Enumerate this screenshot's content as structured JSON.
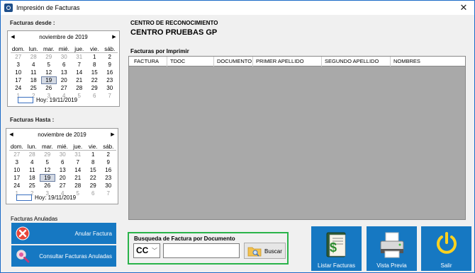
{
  "window": {
    "title": "Impresión de Facturas",
    "close_glyph": "✕"
  },
  "calendar_from": {
    "label": "Facturas desde :",
    "month": "noviembre de 2019",
    "days_of_week": [
      "dom.",
      "lun.",
      "mar.",
      "mié.",
      "jue.",
      "vie.",
      "sáb."
    ],
    "weeks": [
      [
        [
          "27",
          "o"
        ],
        [
          "28",
          "o"
        ],
        [
          "29",
          "o"
        ],
        [
          "30",
          "o"
        ],
        [
          "31",
          "o"
        ],
        [
          "1",
          ""
        ],
        [
          "2",
          ""
        ]
      ],
      [
        [
          "3",
          ""
        ],
        [
          "4",
          ""
        ],
        [
          "5",
          ""
        ],
        [
          "6",
          ""
        ],
        [
          "7",
          ""
        ],
        [
          "8",
          ""
        ],
        [
          "9",
          ""
        ]
      ],
      [
        [
          "10",
          ""
        ],
        [
          "11",
          ""
        ],
        [
          "12",
          ""
        ],
        [
          "13",
          ""
        ],
        [
          "14",
          ""
        ],
        [
          "15",
          ""
        ],
        [
          "16",
          ""
        ]
      ],
      [
        [
          "17",
          ""
        ],
        [
          "18",
          ""
        ],
        [
          "19",
          "s"
        ],
        [
          "20",
          ""
        ],
        [
          "21",
          ""
        ],
        [
          "22",
          ""
        ],
        [
          "23",
          ""
        ]
      ],
      [
        [
          "24",
          ""
        ],
        [
          "25",
          ""
        ],
        [
          "26",
          ""
        ],
        [
          "27",
          ""
        ],
        [
          "28",
          ""
        ],
        [
          "29",
          ""
        ],
        [
          "30",
          ""
        ]
      ],
      [
        [
          "1",
          "o"
        ],
        [
          "2",
          "o"
        ],
        [
          "3",
          "o"
        ],
        [
          "4",
          "o"
        ],
        [
          "5",
          "o"
        ],
        [
          "6",
          "o"
        ],
        [
          "7",
          "o"
        ]
      ]
    ],
    "today": "Hoy: 19/11/2019"
  },
  "calendar_to": {
    "label": "Facturas Hasta :",
    "month": "noviembre de 2019",
    "days_of_week": [
      "dom.",
      "lun.",
      "mar.",
      "mié.",
      "jue.",
      "vie.",
      "sáb."
    ],
    "weeks": [
      [
        [
          "27",
          "o"
        ],
        [
          "28",
          "o"
        ],
        [
          "29",
          "o"
        ],
        [
          "30",
          "o"
        ],
        [
          "31",
          "o"
        ],
        [
          "1",
          ""
        ],
        [
          "2",
          ""
        ]
      ],
      [
        [
          "3",
          ""
        ],
        [
          "4",
          ""
        ],
        [
          "5",
          ""
        ],
        [
          "6",
          ""
        ],
        [
          "7",
          ""
        ],
        [
          "8",
          ""
        ],
        [
          "9",
          ""
        ]
      ],
      [
        [
          "10",
          ""
        ],
        [
          "11",
          ""
        ],
        [
          "12",
          ""
        ],
        [
          "13",
          ""
        ],
        [
          "14",
          ""
        ],
        [
          "15",
          ""
        ],
        [
          "16",
          ""
        ]
      ],
      [
        [
          "17",
          ""
        ],
        [
          "18",
          ""
        ],
        [
          "19",
          "s"
        ],
        [
          "20",
          ""
        ],
        [
          "21",
          ""
        ],
        [
          "22",
          ""
        ],
        [
          "23",
          ""
        ]
      ],
      [
        [
          "24",
          ""
        ],
        [
          "25",
          ""
        ],
        [
          "26",
          ""
        ],
        [
          "27",
          ""
        ],
        [
          "28",
          ""
        ],
        [
          "29",
          ""
        ],
        [
          "30",
          ""
        ]
      ],
      [
        [
          "1",
          "o"
        ],
        [
          "2",
          "o"
        ],
        [
          "3",
          "o"
        ],
        [
          "4",
          "o"
        ],
        [
          "5",
          "o"
        ],
        [
          "6",
          "o"
        ],
        [
          "7",
          "o"
        ]
      ]
    ],
    "today": "Hoy: 19/11/2019"
  },
  "anuladas": {
    "label": "Facturas Anuladas",
    "anular_button": "Anular Factura",
    "consultar_button": "Consultar Facturas Anuladas"
  },
  "center": {
    "label": "CENTRO DE RECONOCIMIENTO",
    "name": "CENTRO PRUEBAS GP"
  },
  "facturas": {
    "label": "Facturas por Imprimir",
    "columns": [
      "FACTURA",
      "TDOC",
      "DOCUMENTO",
      "PRIMER APELLIDO",
      "SEGUNDO APELLIDO",
      "NOMBRES"
    ]
  },
  "search": {
    "title": "Busqueda de Factura por Documento",
    "doc_type": "CC",
    "doc_value": "",
    "button": "Buscar"
  },
  "actions": {
    "listar": "Listar Facturas",
    "vista": "Vista Previa",
    "salir": "Salir"
  },
  "icons": {
    "app": "app-icon",
    "prev": "chevron-left-icon",
    "next": "chevron-right-icon",
    "anular": "cancel-icon",
    "consultar": "magnifier-icon",
    "buscar": "folder-search-icon",
    "listar": "money-list-icon",
    "vista": "printer-icon",
    "salir": "power-icon"
  },
  "colors": {
    "accent": "#1678c2",
    "search_border": "#29b34a",
    "selected_day": "#d3d9e3"
  }
}
